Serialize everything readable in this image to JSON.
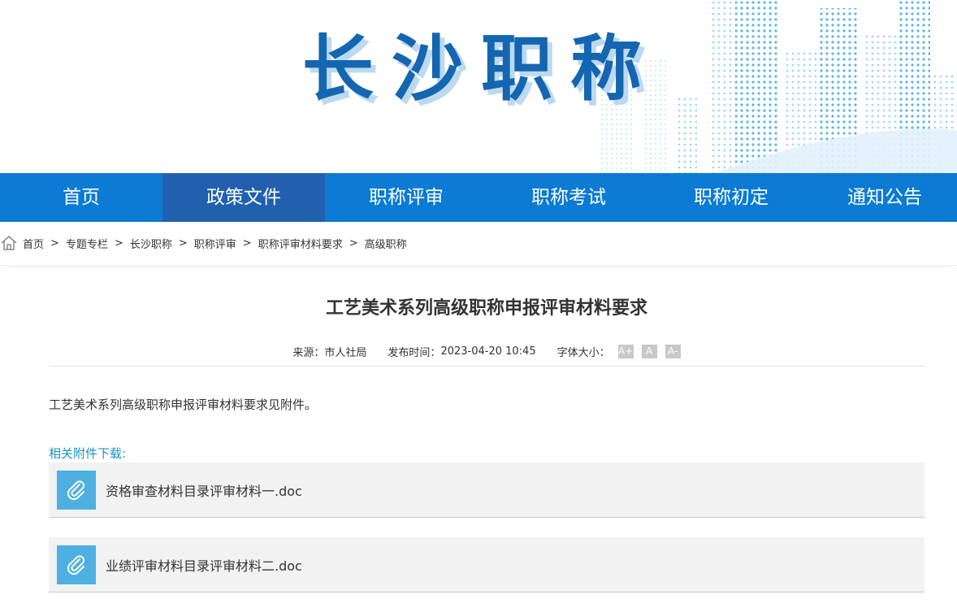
{
  "banner": {
    "title": "长沙职称"
  },
  "nav": {
    "items": [
      {
        "label": "首页"
      },
      {
        "label": "政策文件"
      },
      {
        "label": "职称评审"
      },
      {
        "label": "职称考试"
      },
      {
        "label": "职称初定"
      },
      {
        "label": "通知公告"
      }
    ],
    "active_index": 1
  },
  "breadcrumb": {
    "items": [
      "首页",
      "专题专栏",
      "长沙职称",
      "职称评审",
      "职称评审材料要求",
      "高级职称"
    ],
    "separator": ">"
  },
  "article": {
    "title": "工艺美术系列高级职称申报评审材料要求",
    "source_label": "来源：",
    "source_value": "市人社局",
    "time_label": "发布时间：",
    "time_value": "2023-04-20 10:45",
    "font_size_label": "字体大小：",
    "font_buttons": [
      "A+",
      "A",
      "A-"
    ],
    "body": "工艺美术系列高级职称申报评审材料要求见附件。",
    "attachments_label": "相关附件下载:",
    "attachments": [
      {
        "name": "资格审查材料目录评审材料一.doc"
      },
      {
        "name": "业绩评审材料目录评审材料二.doc"
      }
    ]
  },
  "colors": {
    "nav_bg": "#0b7bd4",
    "nav_active_bg": "#2060ae",
    "title_blue": "#1466b0",
    "attachment_label": "#1a93c8",
    "attachment_icon_bg": "#4db0e0"
  }
}
